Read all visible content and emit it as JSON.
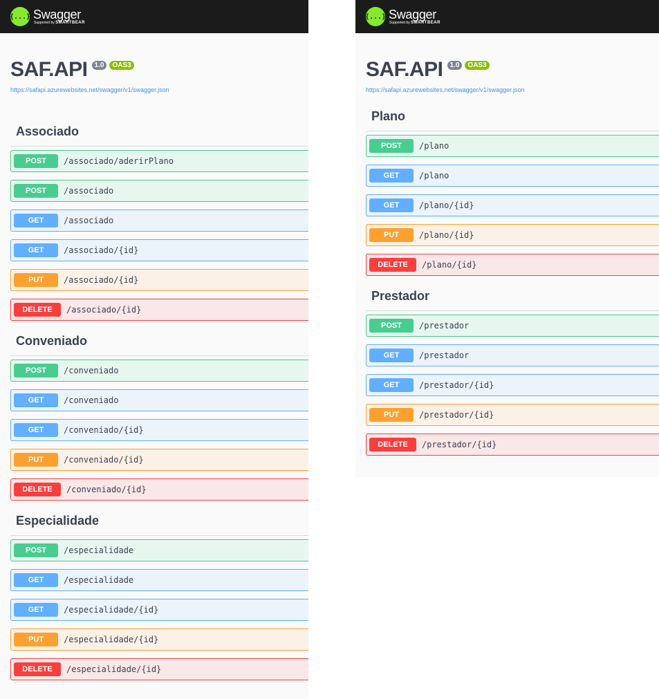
{
  "topbar": {
    "logo_name": "Swagger",
    "logo_sub_small": "Supported by",
    "logo_sub_brand": "SMARTBEAR",
    "logo_symbol": "{...}"
  },
  "info": {
    "title": "SAF.API",
    "version": "1.0",
    "oas": "OAS3",
    "spec_url": "https://safapi.azurewebsites.net/swagger/v1/swagger.json"
  },
  "colors": {
    "post": "#49cc90",
    "get": "#61affe",
    "put": "#fca130",
    "delete": "#f93e3e",
    "topbar": "#1b1b1b",
    "logo": "#85ea2d"
  },
  "left_sections": [
    {
      "tag": "Associado",
      "ops": [
        {
          "method": "POST",
          "path": "/associado/aderirPlano"
        },
        {
          "method": "POST",
          "path": "/associado"
        },
        {
          "method": "GET",
          "path": "/associado"
        },
        {
          "method": "GET",
          "path": "/associado/{id}"
        },
        {
          "method": "PUT",
          "path": "/associado/{id}"
        },
        {
          "method": "DELETE",
          "path": "/associado/{id}"
        }
      ]
    },
    {
      "tag": "Conveniado",
      "ops": [
        {
          "method": "POST",
          "path": "/conveniado"
        },
        {
          "method": "GET",
          "path": "/conveniado"
        },
        {
          "method": "GET",
          "path": "/conveniado/{id}"
        },
        {
          "method": "PUT",
          "path": "/conveniado/{id}"
        },
        {
          "method": "DELETE",
          "path": "/conveniado/{id}"
        }
      ]
    },
    {
      "tag": "Especialidade",
      "ops": [
        {
          "method": "POST",
          "path": "/especialidade"
        },
        {
          "method": "GET",
          "path": "/especialidade"
        },
        {
          "method": "GET",
          "path": "/especialidade/{id}"
        },
        {
          "method": "PUT",
          "path": "/especialidade/{id}"
        },
        {
          "method": "DELETE",
          "path": "/especialidade/{id}"
        }
      ]
    }
  ],
  "right_sections": [
    {
      "tag": "Plano",
      "ops": [
        {
          "method": "POST",
          "path": "/plano"
        },
        {
          "method": "GET",
          "path": "/plano"
        },
        {
          "method": "GET",
          "path": "/plano/{id}"
        },
        {
          "method": "PUT",
          "path": "/plano/{id}"
        },
        {
          "method": "DELETE",
          "path": "/plano/{id}"
        }
      ]
    },
    {
      "tag": "Prestador",
      "ops": [
        {
          "method": "POST",
          "path": "/prestador"
        },
        {
          "method": "GET",
          "path": "/prestador"
        },
        {
          "method": "GET",
          "path": "/prestador/{id}"
        },
        {
          "method": "PUT",
          "path": "/prestador/{id}"
        },
        {
          "method": "DELETE",
          "path": "/prestador/{id}"
        }
      ]
    }
  ]
}
